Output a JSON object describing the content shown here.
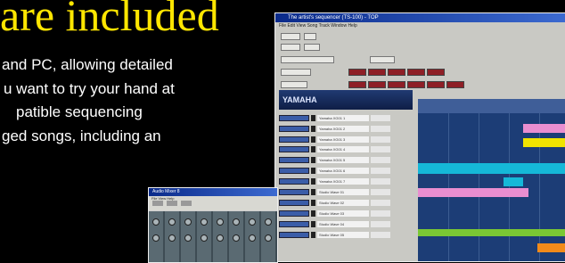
{
  "heading": "are included",
  "paragraph_lines": [
    "and PC, allowing detailed",
    "u want to try your hand at",
    "patible sequencing",
    "ged songs, including an"
  ],
  "sequencer_window": {
    "title": "The artist's sequencer (TS-100) - TOP",
    "menu": "File  Edit  View  Song  Track  Window  Help",
    "logo": "YAMAHA",
    "tracks": [
      "Yamaha XG01 1",
      "Yamaha XG01 2",
      "Yamaha XG01 3",
      "Yamaha XG01 4",
      "Yamaha XG01 5",
      "Yamaha XG01 6",
      "Yamaha XG01 7",
      "Studio Wave 01",
      "Studio Wave 02",
      "Studio Wave 03",
      "Studio Wave 04",
      "Studio Wave 05"
    ],
    "colors": {
      "accent_red": "#8e1f26",
      "grid_bg": "#1c3d76",
      "cyan": "#15b8d8",
      "pink": "#e98ed0",
      "yellow": "#f0e300",
      "green": "#7ac734",
      "orange": "#f28a1a"
    }
  },
  "mixer_window": {
    "title": "Audio Mixer 8",
    "menu": "File  View  Help"
  },
  "colors": {
    "heading": "#ffe600",
    "text": "#ffffff",
    "background": "#000000"
  }
}
